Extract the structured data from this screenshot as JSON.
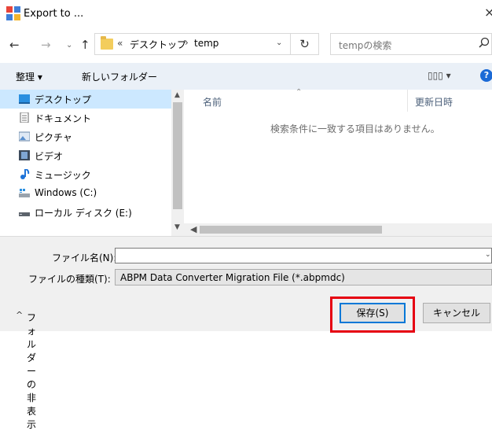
{
  "window": {
    "title": "Export to ...",
    "close_glyph": "×"
  },
  "nav": {
    "back": "←",
    "forward": "→",
    "recent": "⌄",
    "up": "↑"
  },
  "address": {
    "chevron": "«",
    "crumbs": [
      "デスクトップ",
      "temp"
    ],
    "separator": "›",
    "dropdown": "⌄",
    "refresh": "↻"
  },
  "search": {
    "placeholder": "tempの検索",
    "icon": "search-icon"
  },
  "toolbar": {
    "organize": "整理 ▾",
    "new_folder": "新しいフォルダー",
    "view": "▯▯▯ ▾",
    "help": "?"
  },
  "sidebar": {
    "items": [
      {
        "label": "デスクトップ",
        "icon": "desktop-icon",
        "selected": true
      },
      {
        "label": "ドキュメント",
        "icon": "document-icon"
      },
      {
        "label": "ピクチャ",
        "icon": "pictures-icon"
      },
      {
        "label": "ビデオ",
        "icon": "video-icon"
      },
      {
        "label": "ミュージック",
        "icon": "music-icon"
      },
      {
        "label": "Windows (C:)",
        "icon": "drive-c-icon"
      },
      {
        "label": "ローカル ディスク (E:)",
        "icon": "drive-e-icon"
      }
    ]
  },
  "filelist": {
    "col_name": "名前",
    "col_date": "更新日時",
    "empty_message": "検索条件に一致する項目はありません。"
  },
  "form": {
    "filename_label": "ファイル名(N):",
    "filename_value": "",
    "filetype_label": "ファイルの種類(T):",
    "filetype_value": "ABPM Data Converter Migration File (*.abpmdc)"
  },
  "footer": {
    "hide_folders": "フォルダーの非表示",
    "save": "保存(S)",
    "cancel": "キャンセル"
  },
  "colors": {
    "accent": "#0078d7",
    "highlight": "#e60012",
    "selected": "#cce8ff",
    "toolbar_bg": "#eaf0f7"
  }
}
